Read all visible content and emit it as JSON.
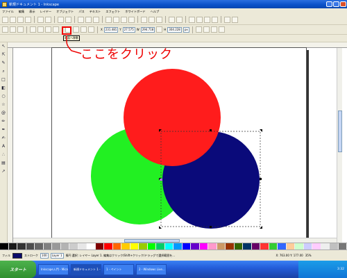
{
  "window": {
    "title": "新規ドキュメント 1 - Inkscape"
  },
  "menubar": {
    "items": [
      "ファイル",
      "編集",
      "表示",
      "レイヤー",
      "オブジェクト",
      "パス",
      "テキスト",
      "エフェクト",
      "ホワイトボード",
      "ヘルプ"
    ]
  },
  "toolbar2": {
    "x_label": "X",
    "x_value": "231.481",
    "y_label": "Y",
    "y_value": "27.575",
    "w_label": "W",
    "w_value": "294.718",
    "h_label": "H",
    "h_value": "304.228",
    "unit": "px"
  },
  "toolbar3": {
    "tooltip": "前面へ移動"
  },
  "annotation": {
    "text": "ここをクリック",
    "color": "#ee0000"
  },
  "canvas": {
    "circles": [
      {
        "name": "red-circle",
        "color": "#ff1c1c"
      },
      {
        "name": "green-circle",
        "color": "#22f022"
      },
      {
        "name": "navy-circle",
        "color": "#0a0a7a"
      }
    ]
  },
  "palette": {
    "colors": [
      "#000000",
      "#1a1a1a",
      "#333333",
      "#4d4d4d",
      "#666666",
      "#808080",
      "#999999",
      "#b3b3b3",
      "#cccccc",
      "#e6e6e6",
      "#ffffff",
      "#800000",
      "#ff0000",
      "#ff6600",
      "#ffcc00",
      "#ffff00",
      "#99cc00",
      "#00ff00",
      "#00cc66",
      "#00ffff",
      "#0099ff",
      "#0000ff",
      "#6600cc",
      "#ff00ff",
      "#ff99cc",
      "#cc9966",
      "#993300",
      "#336600",
      "#003366",
      "#660066",
      "#ff3333",
      "#33cc33",
      "#3366ff",
      "#ffcc99",
      "#ccffcc",
      "#ccccff",
      "#ffccff",
      "#eeeeee",
      "#c0c0c0",
      "#777777"
    ]
  },
  "statusbar": {
    "fill_label": "フィル",
    "stroke_label": "ストローク",
    "opacity": "100",
    "layer": "Layer 1",
    "message": "楕円 選択: レイヤー Layer 1. 編集はクリック/Shift+クリック/ドラッグで選択範囲を...",
    "coords": "X: 763.00 Y: 177.00",
    "zoom": "35%"
  },
  "taskbar": {
    "start_label": "スタート",
    "items": [
      "Inkscape入門 - Microsoft...",
      "新規ドキュメント 1 - Ink...",
      "1 - ペイント",
      "2 - Windows Live..."
    ],
    "time": "3:32"
  }
}
